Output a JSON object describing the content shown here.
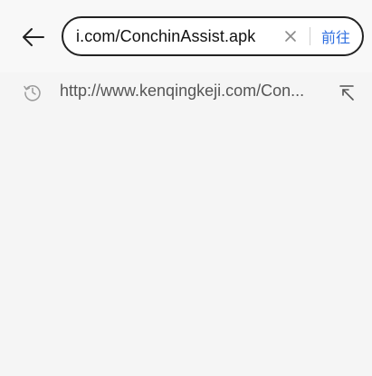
{
  "toolbar": {
    "back_icon": "arrow-left-icon",
    "url_value": "i.com/ConchinAssist.apk",
    "clear_icon": "close-icon",
    "go_label": "前往",
    "accent_color": "#2f6fe0"
  },
  "suggestions": [
    {
      "icon": "history-icon",
      "text": "http://www.kenqingkeji.com/Con...",
      "action_icon": "arrow-up-left-icon"
    }
  ]
}
